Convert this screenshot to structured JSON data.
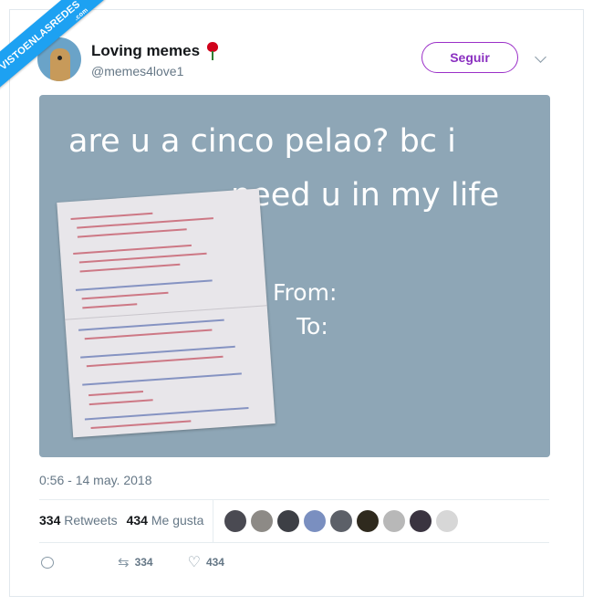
{
  "watermark": {
    "text": "VISTOENLASREDES",
    "sub": ".com"
  },
  "account": {
    "name": "Loving memes",
    "handle": "@memes4love1"
  },
  "follow_button": {
    "label": "Seguir"
  },
  "image": {
    "line1": "are u a cinco pelao? bc i",
    "line2": "need u in my life",
    "from_label": "From:",
    "to_label": "To:"
  },
  "timestamp": "0:56 - 14 may. 2018",
  "stats": {
    "retweets_count": "334",
    "retweets_label": "Retweets",
    "likes_count": "434",
    "likes_label": "Me gusta"
  },
  "liker_avatars": [
    "#4a4a52",
    "#8d8a86",
    "#3d3f45",
    "#7a8fc0",
    "#5c6068",
    "#2f2a1e",
    "#b8b8b8",
    "#3a3440",
    "#d7d7d7"
  ],
  "actions": {
    "retweet_count": "334",
    "like_count": "434"
  },
  "colors": {
    "accent": "#8a2fc0",
    "media_bg": "#8ea6b6",
    "watermark": "#1da1f2"
  }
}
